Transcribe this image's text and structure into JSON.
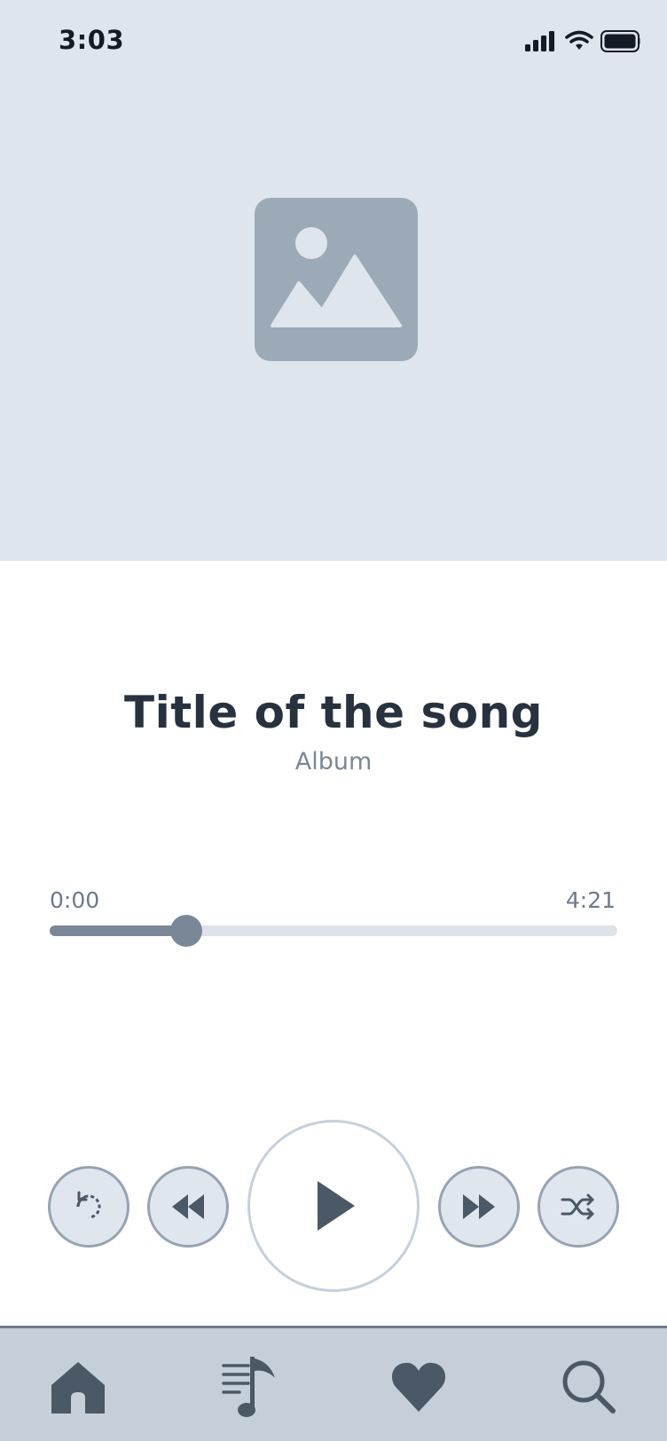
{
  "status_bar": {
    "time": "3:03",
    "icons": [
      "signal-icon",
      "wifi-icon",
      "battery-icon"
    ]
  },
  "album_art": {
    "icon": "image-placeholder-icon"
  },
  "song": {
    "title": "Title of the song",
    "album": "Album"
  },
  "playback": {
    "elapsed": "0:00",
    "duration": "4:21",
    "progress_fraction": 0.24
  },
  "controls": [
    "repeat-icon",
    "rewind-icon",
    "play-icon",
    "fast-forward-icon",
    "shuffle-icon"
  ],
  "bottom_nav": [
    "home-icon",
    "playlist-icon",
    "heart-icon",
    "search-icon"
  ],
  "colors": {
    "hero_bg": "#dfe5ed",
    "nav_bg": "#c4cfd9",
    "accent": "#7a8797",
    "icon_dark": "#4b5866"
  }
}
